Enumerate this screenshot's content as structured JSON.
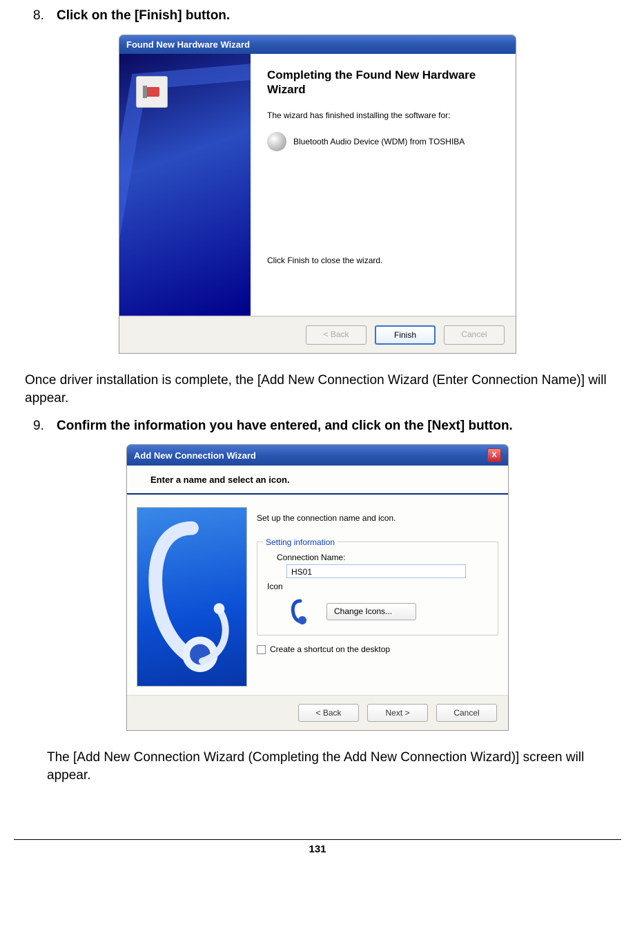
{
  "step8": {
    "num": "8.",
    "text": "Click on the [Finish] button."
  },
  "wiz1": {
    "title": "Found New Hardware Wizard",
    "heading": "Completing the Found New Hardware Wizard",
    "p1": "The wizard has finished installing the software for:",
    "device": "Bluetooth Audio Device (WDM) from TOSHIBA",
    "closeHint": "Click Finish to close the wizard.",
    "back": "< Back",
    "finish": "Finish",
    "cancel": "Cancel"
  },
  "midText": "Once driver installation is complete, the [Add New Connection Wizard (Enter Connection Name)] will appear.",
  "step9": {
    "num": "9.",
    "text": "Confirm the information you have entered, and click on the [Next] button."
  },
  "wiz2": {
    "title": "Add New Connection Wizard",
    "close": "X",
    "head": "Enter a name and select an icon.",
    "hint": "Set up the connection name and icon.",
    "legend": "Setting information",
    "connNameLabel": "Connection Name:",
    "connNameValue": "HS01",
    "iconLabel": "Icon",
    "changeIcons": "Change Icons...",
    "shortcut": "Create a shortcut on the desktop",
    "back": "< Back",
    "next": "Next >",
    "cancel": "Cancel"
  },
  "afterText": "The [Add New Connection Wizard (Completing the Add New Connection Wizard)] screen will appear.",
  "pageNumber": "131"
}
